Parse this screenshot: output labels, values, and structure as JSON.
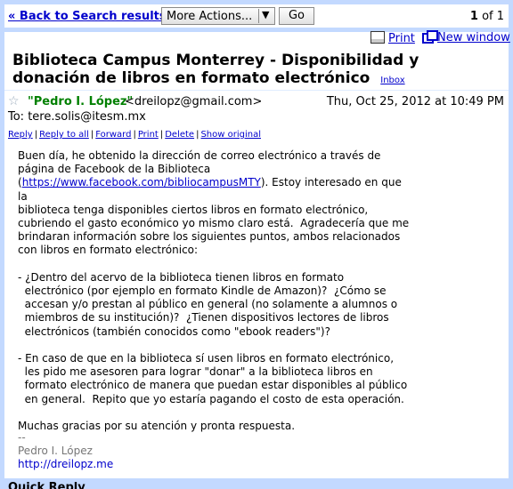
{
  "toolbar": {
    "back_label": "« Back to Search results",
    "more_actions_label": "More Actions...",
    "go_label": "Go",
    "pager_current": "1",
    "pager_total": "of 1",
    "print_label": "Print",
    "new_window_label": "New window"
  },
  "message": {
    "subject": "Biblioteca Campus Monterrey - Disponibilidad y donación de libros en formato electrónico",
    "label": "Inbox",
    "sender_name": "\"Pedro I. López\"",
    "sender_email": "<dreilopz@gmail.com>",
    "date": "Thu, Oct 25, 2012 at 10:49 PM",
    "to": "To: tere.solis@itesm.mx",
    "actions": [
      "Reply",
      "Reply to all",
      "Forward",
      "Print",
      "Delete",
      "Show original"
    ],
    "body_p1": "Buen día, he obtenido la dirección de correo electrónico a través de\npágina de Facebook de la Biblioteca\n(",
    "body_link": "https://www.facebook.com/bibliocampusMTY",
    "body_p1b": "). Estoy interesado en que la\nbiblioteca tenga disponibles ciertos libros en formato electrónico,\ncubriendo el gasto económico yo mismo claro está.  Agradecería que me\nbrindaran información sobre los siguientes puntos, ambos relacionados\ncon libros en formato electrónico:\n\n- ¿Dentro del acervo de la biblioteca tienen libros en formato\n  electrónico (por ejemplo en formato Kindle de Amazon)?  ¿Cómo se\n  accesan y/o prestan al público en general (no solamente a alumnos o\n  miembros de su institución)?  ¿Tienen dispositivos lectores de libros\n  electrónicos (también conocidos como \"ebook readers\")?\n\n- En caso de que en la biblioteca sí usen libros en formato electrónico,\n  les pido me asesoren para lograr \"donar\" a la biblioteca libros en\n  formato electrónico de manera que puedan estar disponibles al público\n  en general.  Repito que yo estaría pagando el costo de esta operación.\n\nMuchas gracias por su atención y pronta respuesta.",
    "sig_dashes": "--",
    "sig_name": "Pedro I. López",
    "sig_url": "http://dreilopz.me"
  },
  "quick_reply_label": "Quick Reply",
  "colors": {
    "frame": "#c3d9ff",
    "link": "#0000cc",
    "sender": "#008000"
  }
}
